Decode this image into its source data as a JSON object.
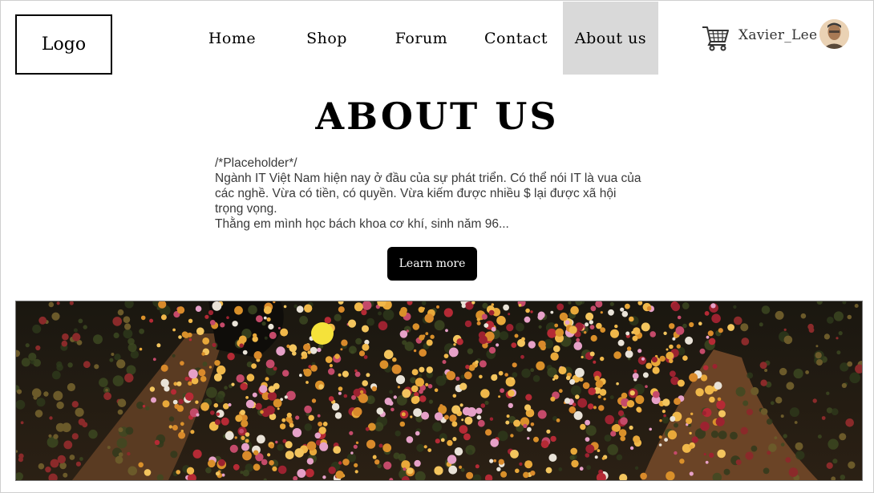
{
  "header": {
    "logo_label": "Logo",
    "nav": [
      "Home",
      "Shop",
      "Forum",
      "Contact",
      "About us"
    ],
    "active_nav": "About us",
    "username": "Xavier_Lee"
  },
  "main": {
    "title": "ABOUT US",
    "paragraphs": [
      "/*Placeholder*/",
      "Ngành IT Việt Nam hiện nay ở đầu của sự phát triển. Có thể nói IT là vua của các nghề. Vừa có tiền, có quyền. Vừa kiếm được nhiều $ lại được xã hội trọng vọng.",
      "Thằng em mình học bách khoa cơ khí, sinh năm 96..."
    ],
    "button_label": "Learn more"
  },
  "icons": {
    "cart": "shopping-cart-icon",
    "avatar": "user-avatar"
  },
  "colors": {
    "active_nav_bg": "#d9d9d9",
    "button_bg": "#000000",
    "button_text": "#ffffff"
  }
}
